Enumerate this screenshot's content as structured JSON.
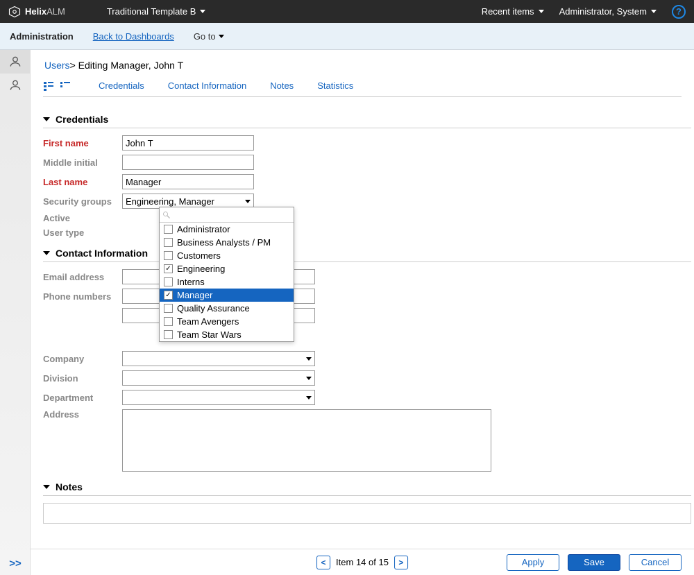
{
  "topbar": {
    "brand_pre": "Helix",
    "brand_post": "ALM",
    "template": "Traditional Template B",
    "recent": "Recent items",
    "user": "Administrator, System"
  },
  "subbar": {
    "admin": "Administration",
    "back": "Back to Dashboards",
    "goto": "Go to"
  },
  "breadcrumb": {
    "root": "Users",
    "current": "> Editing Manager, John T"
  },
  "tabs": {
    "credentials": "Credentials",
    "contact": "Contact Information",
    "notes": "Notes",
    "stats": "Statistics"
  },
  "sections": {
    "credentials": "Credentials",
    "contact": "Contact Information",
    "notes": "Notes"
  },
  "labels": {
    "first_name": "First name",
    "middle_initial": "Middle initial",
    "last_name": "Last name",
    "security_groups": "Security groups",
    "active": "Active",
    "user_type": "User type",
    "email": "Email address",
    "phone": "Phone numbers",
    "company": "Company",
    "division": "Division",
    "department": "Department",
    "address": "Address"
  },
  "values": {
    "first_name": "John T",
    "middle_initial": "",
    "last_name": "Manager",
    "security_groups": "Engineering, Manager",
    "company": "",
    "division": "",
    "department": "",
    "address": ""
  },
  "dropdown": {
    "items": [
      {
        "label": "Administrator",
        "checked": false
      },
      {
        "label": "Business Analysts / PM",
        "checked": false
      },
      {
        "label": "Customers",
        "checked": false
      },
      {
        "label": "Engineering",
        "checked": true
      },
      {
        "label": "Interns",
        "checked": false
      },
      {
        "label": "Manager",
        "checked": true,
        "highlight": true
      },
      {
        "label": "Quality Assurance",
        "checked": false
      },
      {
        "label": "Team Avengers",
        "checked": false
      },
      {
        "label": "Team Star Wars",
        "checked": false
      }
    ]
  },
  "footer": {
    "pager": "Item 14 of 15",
    "apply": "Apply",
    "save": "Save",
    "cancel": "Cancel"
  }
}
